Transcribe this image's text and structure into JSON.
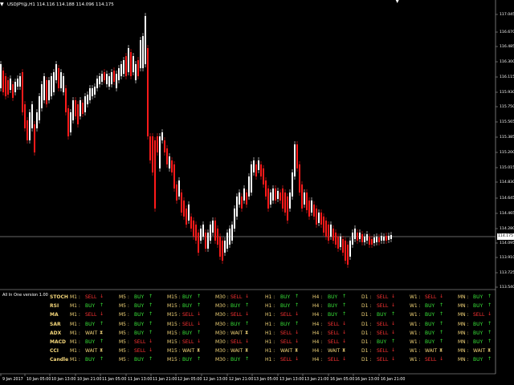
{
  "window": {
    "symbol_info": "USDJPY@,H1  114.116 114.188 114.096 114.175",
    "top_marker": "▼",
    "triangle": "▼"
  },
  "price_axis": {
    "ticks": [
      "117.045",
      "116.670",
      "116.485",
      "116.300",
      "116.115",
      "115.930",
      "115.750",
      "115.565",
      "115.385",
      "115.200",
      "115.015",
      "114.830",
      "114.645",
      "114.465",
      "114.280",
      "114.095",
      "113.910",
      "113.725",
      "113.540"
    ],
    "current_price": "114.175"
  },
  "time_axis": {
    "ticks": [
      "9 Jan 2017",
      "10 Jan 05:00",
      "10 Jan 13:00",
      "10 Jan 21:00",
      "11 Jan 05:00",
      "11 Jan 13:00",
      "11 Jan 21:00",
      "12 Jan 05:00",
      "12 Jan 13:00",
      "12 Jan 21:00",
      "13 Jan 05:00",
      "13 Jan 13:00",
      "13 Jan 21:00",
      "16 Jan 05:00",
      "16 Jan 13:00",
      "16 Jan 21:00"
    ]
  },
  "panel": {
    "title": "All In One version 1.00",
    "timeframes": [
      "M1",
      "M5",
      "M15",
      "M30",
      "H1",
      "H4",
      "D1",
      "W1",
      "MN"
    ],
    "rows": [
      {
        "name": "STOCH",
        "signals": [
          [
            "M1 : ",
            "SELL",
            "sell"
          ],
          [
            "M5 : ",
            "BUY",
            "buy"
          ],
          [
            "M15 :",
            "BUY",
            "buy"
          ],
          [
            "M30 :",
            "SELL",
            "sell"
          ],
          [
            "H1 : ",
            "BUY",
            "buy"
          ],
          [
            "H4 : ",
            "BUY",
            "buy"
          ],
          [
            "D1 : ",
            "SELL",
            "sell"
          ],
          [
            "W1 : ",
            "SELL",
            "sell"
          ],
          [
            "MN : ",
            "BUY",
            "buy"
          ]
        ]
      },
      {
        "name": "RSI",
        "signals": [
          [
            "M1 : ",
            "BUY",
            "buy"
          ],
          [
            "M5 : ",
            "BUY",
            "buy"
          ],
          [
            "M15 :",
            "BUY",
            "buy"
          ],
          [
            "M30 :",
            "BUY",
            "buy"
          ],
          [
            "H1 : ",
            "BUY",
            "buy"
          ],
          [
            "H4 : ",
            "BUY",
            "buy"
          ],
          [
            "D1 : ",
            "SELL",
            "sell"
          ],
          [
            "W1 : ",
            "BUY",
            "buy"
          ],
          [
            "MN : ",
            "BUY",
            "buy"
          ]
        ]
      },
      {
        "name": "MA",
        "signals": [
          [
            "M1 : ",
            "SELL",
            "sell"
          ],
          [
            "M5 : ",
            "BUY",
            "buy"
          ],
          [
            "M15 :",
            "SELL",
            "sell"
          ],
          [
            "M30 :",
            "SELL",
            "sell"
          ],
          [
            "H1 : ",
            "SELL",
            "sell"
          ],
          [
            "H4 : ",
            "BUY",
            "buy"
          ],
          [
            "D1 : ",
            "BUY",
            "buy"
          ],
          [
            "W1 : ",
            "BUY",
            "buy"
          ],
          [
            "MN : ",
            "SELL",
            "sell"
          ]
        ]
      },
      {
        "name": "SAR",
        "signals": [
          [
            "M1 : ",
            "BUY",
            "buy"
          ],
          [
            "M5 : ",
            "BUY",
            "buy"
          ],
          [
            "M15 :",
            "SELL",
            "sell"
          ],
          [
            "M30 :",
            "BUY",
            "buy"
          ],
          [
            "H1 : ",
            "BUY",
            "buy"
          ],
          [
            "H4 : ",
            "SELL",
            "sell"
          ],
          [
            "D1 : ",
            "SELL",
            "sell"
          ],
          [
            "W1 : ",
            "BUY",
            "buy"
          ],
          [
            "MN : ",
            "BUY",
            "buy"
          ]
        ]
      },
      {
        "name": "ADX",
        "signals": [
          [
            "M1 : ",
            "WAIT",
            "wait"
          ],
          [
            "M5 : ",
            "BUY",
            "buy"
          ],
          [
            "M15 :",
            "BUY",
            "buy"
          ],
          [
            "M30 :",
            "WAIT",
            "wait"
          ],
          [
            "H1 : ",
            "SELL",
            "sell"
          ],
          [
            "H4 : ",
            "SELL",
            "sell"
          ],
          [
            "D1 : ",
            "SELL",
            "sell"
          ],
          [
            "W1 : ",
            "BUY",
            "buy"
          ],
          [
            "MN : ",
            "BUY",
            "buy"
          ]
        ]
      },
      {
        "name": "MACD",
        "signals": [
          [
            "M1 : ",
            "BUY",
            "buy"
          ],
          [
            "M5 : ",
            "SELL",
            "sell"
          ],
          [
            "M15 :",
            "SELL",
            "sell"
          ],
          [
            "M30 :",
            "SELL",
            "sell"
          ],
          [
            "H1 : ",
            "SELL",
            "sell"
          ],
          [
            "H4 : ",
            "SELL",
            "sell"
          ],
          [
            "D1 : ",
            "BUY",
            "buy"
          ],
          [
            "W1 : ",
            "BUY",
            "buy"
          ],
          [
            "MN : ",
            "BUY",
            "buy"
          ]
        ]
      },
      {
        "name": "CCI",
        "signals": [
          [
            "M1 : ",
            "WAIT",
            "wait"
          ],
          [
            "M5 : ",
            "SELL",
            "sell"
          ],
          [
            "M15 :",
            "WAIT",
            "wait"
          ],
          [
            "M30 :",
            "WAIT",
            "wait"
          ],
          [
            "H1 : ",
            "WAIT",
            "wait"
          ],
          [
            "H4 : ",
            "WAIT",
            "wait"
          ],
          [
            "D1 : ",
            "SELL",
            "sell"
          ],
          [
            "W1 : ",
            "WAIT",
            "wait"
          ],
          [
            "MN : ",
            "WAIT",
            "wait"
          ]
        ]
      },
      {
        "name": "Candle",
        "signals": [
          [
            "M1 : ",
            "BUY",
            "buy"
          ],
          [
            "M5 : ",
            "BUY",
            "buy"
          ],
          [
            "M15 :",
            "BUY",
            "buy"
          ],
          [
            "M30 :",
            "BUY",
            "buy"
          ],
          [
            "H1 : ",
            "SELL",
            "sell"
          ],
          [
            "H4 : ",
            "SELL",
            "sell"
          ],
          [
            "D1 : ",
            "SELL",
            "sell"
          ],
          [
            "W1 : ",
            "SELL",
            "sell"
          ],
          [
            "MN : ",
            "BUY",
            "buy"
          ]
        ]
      }
    ]
  },
  "colors": {
    "bull": "#ffffff",
    "bear": "#ff1a1a",
    "buy": "#39e639",
    "sell": "#ff3333",
    "wait": "#f4d67a",
    "grid": "#ffffff"
  }
}
